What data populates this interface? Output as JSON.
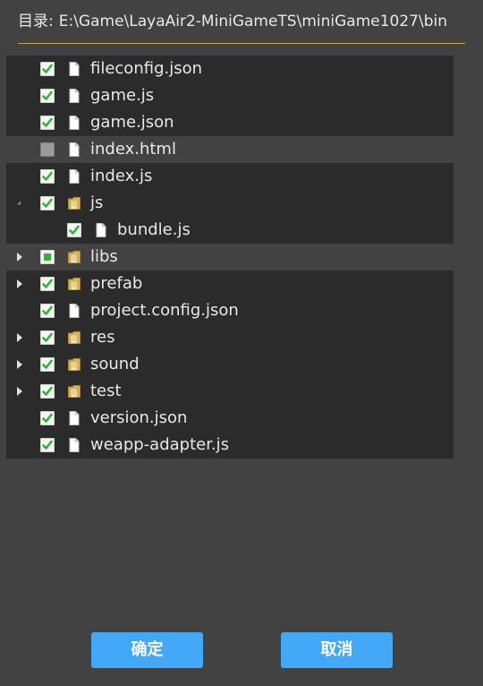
{
  "header": {
    "label": "目录:",
    "path": "E:\\Game\\LayaAir2-MiniGameTS\\miniGame1027\\bin"
  },
  "tree": [
    {
      "name": "fileconfig.json",
      "type": "file",
      "checked": "checked",
      "level": 0,
      "expander": "none"
    },
    {
      "name": "game.js",
      "type": "file",
      "checked": "checked",
      "level": 0,
      "expander": "none"
    },
    {
      "name": "game.json",
      "type": "file",
      "checked": "checked",
      "level": 0,
      "expander": "none"
    },
    {
      "name": "index.html",
      "type": "file",
      "checked": "unchecked",
      "level": 0,
      "expander": "none"
    },
    {
      "name": "index.js",
      "type": "file",
      "checked": "checked",
      "level": 0,
      "expander": "none"
    },
    {
      "name": "js",
      "type": "folder",
      "checked": "checked",
      "level": 0,
      "expander": "expanded"
    },
    {
      "name": "bundle.js",
      "type": "file",
      "checked": "checked",
      "level": 1,
      "expander": "none"
    },
    {
      "name": "libs",
      "type": "folder",
      "checked": "partial",
      "level": 0,
      "expander": "collapsed"
    },
    {
      "name": "prefab",
      "type": "folder",
      "checked": "checked",
      "level": 0,
      "expander": "collapsed"
    },
    {
      "name": "project.config.json",
      "type": "file",
      "checked": "checked",
      "level": 0,
      "expander": "none"
    },
    {
      "name": "res",
      "type": "folder",
      "checked": "checked",
      "level": 0,
      "expander": "collapsed"
    },
    {
      "name": "sound",
      "type": "folder",
      "checked": "checked",
      "level": 0,
      "expander": "collapsed"
    },
    {
      "name": "test",
      "type": "folder",
      "checked": "checked",
      "level": 0,
      "expander": "collapsed"
    },
    {
      "name": "version.json",
      "type": "file",
      "checked": "checked",
      "level": 0,
      "expander": "none"
    },
    {
      "name": "weapp-adapter.js",
      "type": "file",
      "checked": "checked",
      "level": 0,
      "expander": "none"
    }
  ],
  "buttons": {
    "confirm": "确定",
    "cancel": "取消"
  },
  "colors": {
    "accent": "#43a8f7",
    "check": "#2fb52f",
    "folder": "#d9b45a",
    "divider": "#c9a23a"
  }
}
